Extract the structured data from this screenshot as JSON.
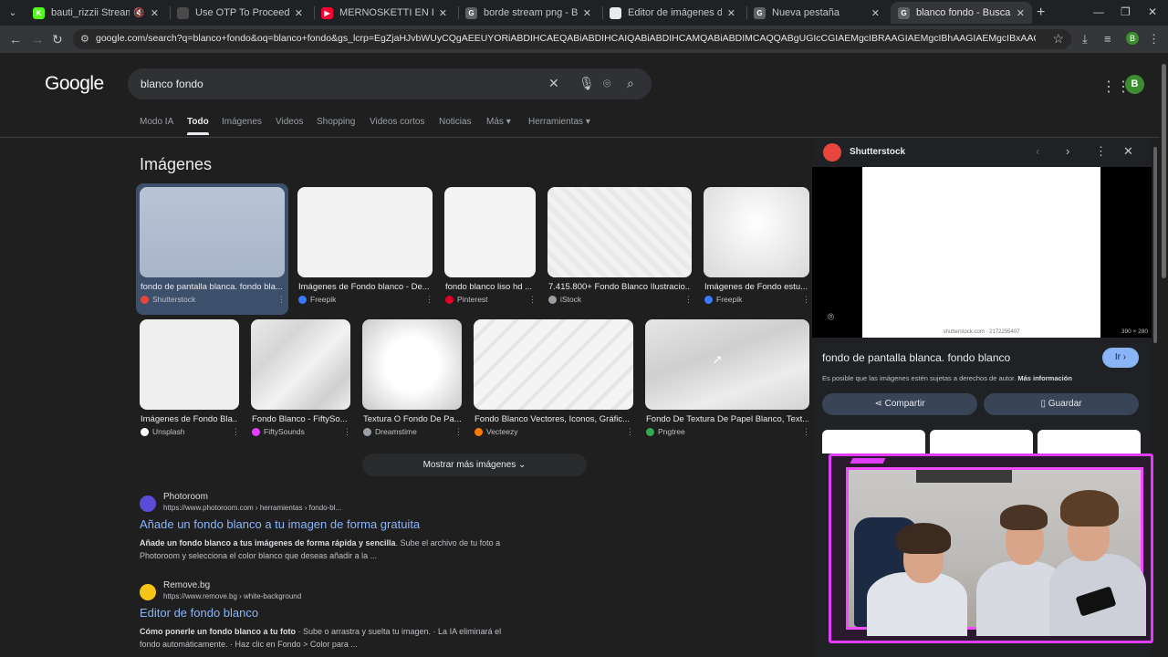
{
  "browser": {
    "tabs": [
      {
        "title": "bauti_rizzii Stream - Watch",
        "favicon_color": "#53fc18",
        "favicon_char": "K",
        "muted": true
      },
      {
        "title": "Use OTP To Proceed - chicheri",
        "favicon_color": "#4a4a4a",
        "favicon_char": "",
        "muted": false
      },
      {
        "title": "MERNOSKETTI EN FERNÉ CON",
        "favicon_color": "#ff0033",
        "favicon_char": "▶",
        "muted": false
      },
      {
        "title": "borde stream png - Buscar con",
        "favicon_color": "#5f6368",
        "favicon_char": "G",
        "muted": false
      },
      {
        "title": "Editor de imágenes de IA - Pix",
        "favicon_color": "#e8eaed",
        "favicon_char": "",
        "muted": false
      },
      {
        "title": "Nueva pestaña",
        "favicon_color": "#5f6368",
        "favicon_char": "G",
        "muted": false
      },
      {
        "title": "blanco fondo - Buscar con Goo",
        "favicon_color": "#5f6368",
        "favicon_char": "G",
        "muted": false,
        "active": true
      }
    ],
    "url": "google.com/search?q=blanco+fondo&oq=blanco+fondo&gs_lcrp=EgZjaHJvbWUyCQgAEEUYORiABDIHCAEQABiABDIHCAIQABiABDIHCAMQABiABDIMCAQQABgUGIcCGIAEMgcIBRAAGIAEMgcIBhAAGIAEMgcIBxAAGIAEMgcICBAAGIAEMgcICRAAGIAEM0...",
    "profile_initial": "B"
  },
  "google": {
    "logo": "Google",
    "query": "blanco fondo",
    "avatar_initial": "B",
    "tabs": [
      "Modo IA",
      "Todo",
      "Imágenes",
      "Videos",
      "Shopping",
      "Videos cortos",
      "Noticias",
      "Más",
      "Herramientas"
    ],
    "active_tab": "Todo"
  },
  "images": {
    "title": "Imágenes",
    "row1": [
      {
        "caption": "fondo de pantalla blanca. fondo bla...",
        "source": "Shutterstock",
        "src_color": "#e8453c",
        "selected": true
      },
      {
        "caption": "Imágenes de Fondo blanco - De...",
        "source": "Freepik",
        "src_color": "#3a7bfd"
      },
      {
        "caption": "fondo blanco liso hd ...",
        "source": "Pinterest",
        "src_color": "#e60023"
      },
      {
        "caption": "7.415.800+ Fondo Blanco Ilustracio...",
        "source": "iStock",
        "src_color": "#9aa0a6"
      },
      {
        "caption": "Imágenes de Fondo estu...",
        "source": "Freepik",
        "src_color": "#3a7bfd"
      }
    ],
    "row2": [
      {
        "caption": "Imágenes de Fondo Bla...",
        "source": "Unsplash",
        "src_color": "#ffffff"
      },
      {
        "caption": "Fondo Blanco - FiftySo...",
        "source": "FiftySounds",
        "src_color": "#e040fb"
      },
      {
        "caption": "Textura O Fondo De Pa...",
        "source": "Dreamstime",
        "src_color": "#9aa0a6"
      },
      {
        "caption": "Fondo Blanco Vectores, Iconos, Gráfic...",
        "source": "Vecteezy",
        "src_color": "#ff7a00"
      },
      {
        "caption": "Fondo De Textura De Papel Blanco, Text...",
        "source": "Pngtree",
        "src_color": "#34a853"
      }
    ],
    "more_label": "Mostrar más imágenes"
  },
  "results": [
    {
      "site": "Photoroom",
      "url": "https://www.photoroom.com › herramientas › fondo-bl...",
      "title": "Añade un fondo blanco a tu imagen de forma gratuita",
      "snippet_bold": "Añade un fondo blanco a tus imágenes de forma rápida y sencilla",
      "snippet": ". Sube el archivo de tu foto a Photoroom y selecciona el color blanco que deseas añadir a la ...",
      "fav_color": "#5b4bdb"
    },
    {
      "site": "Remove.bg",
      "url": "https://www.remove.bg › white-background",
      "title": "Editor de fondo blanco",
      "snippet_bold": "Cómo ponerle un fondo blanco a tu foto",
      "snippet": " · Sube o arrastra y suelta tu imagen. · La IA eliminará el fondo automáticamente. · Haz clic en Fondo > Color para ...",
      "fav_color": "#f5c518"
    }
  ],
  "panel": {
    "source": "Shutterstock",
    "watermark": "shutterstock.com · 2172255407",
    "dims": "390 × 280",
    "title": "fondo de pantalla blanca. fondo blanco",
    "go_label": "Ir",
    "license_text": "Es posible que las imágenes estén sujetas a derechos de autor.",
    "license_link": "Más información",
    "share_label": "Compartir",
    "save_label": "Guardar"
  }
}
